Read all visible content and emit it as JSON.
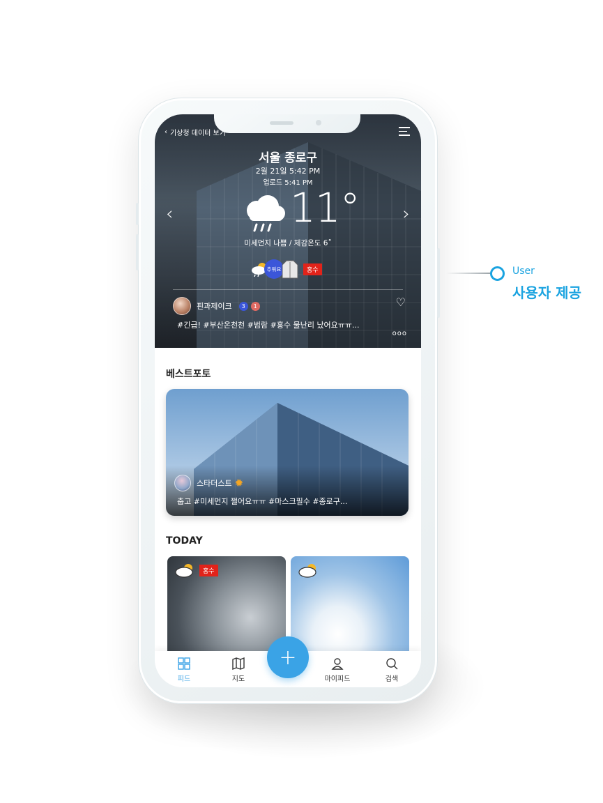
{
  "hero": {
    "back_label": "기상청 데이터 보기",
    "city": "서울 종로구",
    "datetime": "2월 21일 5:42 PM",
    "upload": "업로드 5:41 PM",
    "temperature": "11°",
    "air": "미세먼지 나쁨 / 체감온도 6˚",
    "badge_cold": "추워요",
    "badge_flood": "홍수",
    "user_name": "핀과제이크",
    "user_badge_1": "3",
    "user_badge_2": "1",
    "tags": "#긴급! #부산온천천 #범람 #홍수 물난리 났어요ㅠㅠ...",
    "more": "ooo"
  },
  "best": {
    "title": "베스트포토",
    "user_name": "스타더스트",
    "tags": "춥고 #미세먼지 쩔어요ㅠㅠ #마스크필수 #종로구..."
  },
  "today": {
    "title": "TODAY",
    "card1_badge": "홍수"
  },
  "nav": {
    "feed": "피드",
    "map": "지도",
    "add": "+",
    "mypage": "마이피드",
    "search": "검색"
  },
  "annotation": {
    "en": "User",
    "ko": "사용자 제공"
  },
  "colors": {
    "accent": "#3aa3e6",
    "flood": "#e2231a",
    "cold_badge": "#3b56d9",
    "annotation": "#1aa3e0"
  }
}
